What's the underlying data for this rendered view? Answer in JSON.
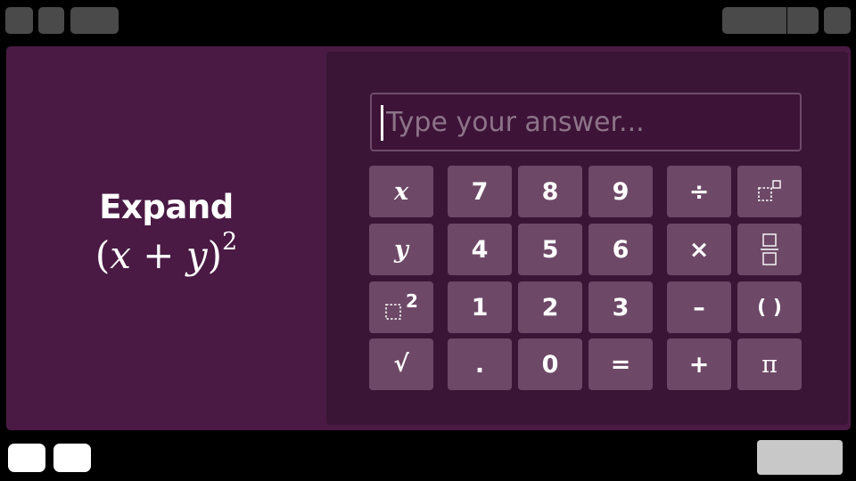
{
  "problem": {
    "title": "Expand",
    "expression": {
      "open": "(",
      "var1": "x",
      "op": " + ",
      "var2": "y",
      "close": ")",
      "exponent": "2"
    }
  },
  "answer": {
    "placeholder": "Type your answer...",
    "value": ""
  },
  "keypad": {
    "var_x": "x",
    "var_y": "y",
    "sqrt": "√",
    "k7": "7",
    "k8": "8",
    "k9": "9",
    "k4": "4",
    "k5": "5",
    "k6": "6",
    "k1": "1",
    "k2": "2",
    "k3": "3",
    "dot": ".",
    "k0": "0",
    "equals": "=",
    "divide": "÷",
    "times": "×",
    "minus": "–",
    "plus": "+",
    "parens": "( )",
    "pi": "π",
    "square_exponent": "2"
  },
  "colors": {
    "panel": "#4a1a44",
    "keypad_bg": "#3a1535",
    "key": "#6d4967",
    "text": "#ffffff",
    "placeholder": "#8d7389"
  }
}
